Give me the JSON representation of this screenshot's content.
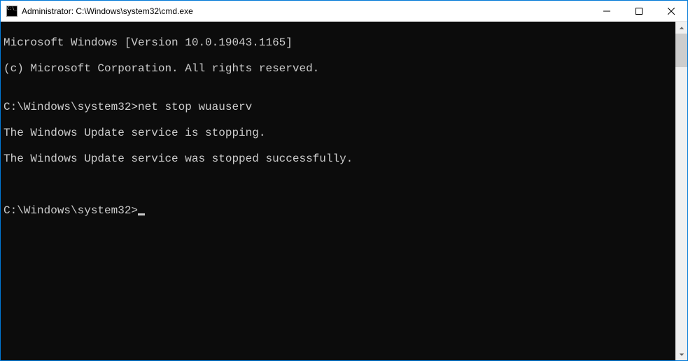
{
  "window": {
    "title": "Administrator: C:\\Windows\\system32\\cmd.exe"
  },
  "terminal": {
    "lines": [
      "Microsoft Windows [Version 10.0.19043.1165]",
      "(c) Microsoft Corporation. All rights reserved.",
      "",
      "C:\\Windows\\system32>net stop wuauserv",
      "The Windows Update service is stopping.",
      "The Windows Update service was stopped successfully.",
      "",
      ""
    ],
    "prompt": "C:\\Windows\\system32>"
  }
}
